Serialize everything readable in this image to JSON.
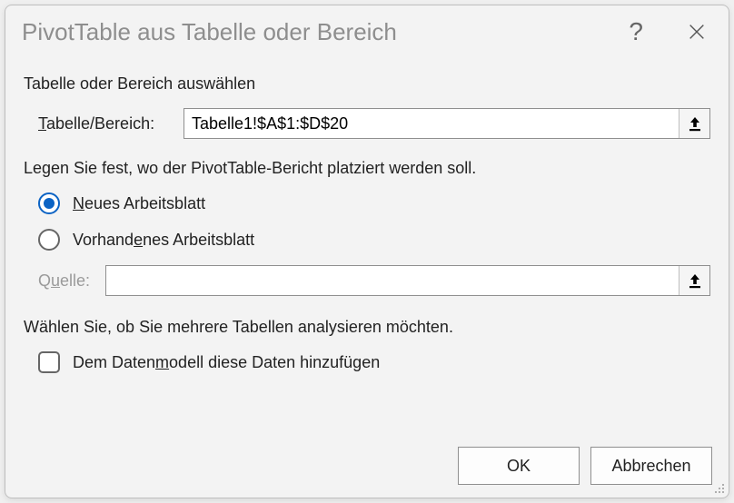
{
  "dialog": {
    "title": "PivotTable aus Tabelle oder Bereich",
    "section_select": "Tabelle oder Bereich auswählen",
    "table_range_label": "Tabelle/Bereich:",
    "table_range_value": "Tabelle1!$A$1:$D$20",
    "section_place": "Legen Sie fest, wo der PivotTable-Bericht platziert werden soll.",
    "radio_new": "Neues Arbeitsblatt",
    "radio_existing": "Vorhandenes Arbeitsblatt",
    "source_label": "Quelle:",
    "source_value": "",
    "section_multi": "Wählen Sie, ob Sie mehrere Tabellen analysieren möchten.",
    "checkbox_datamodel": "Dem Datenmodell diese Daten hinzufügen",
    "btn_ok": "OK",
    "btn_cancel": "Abbrechen"
  }
}
